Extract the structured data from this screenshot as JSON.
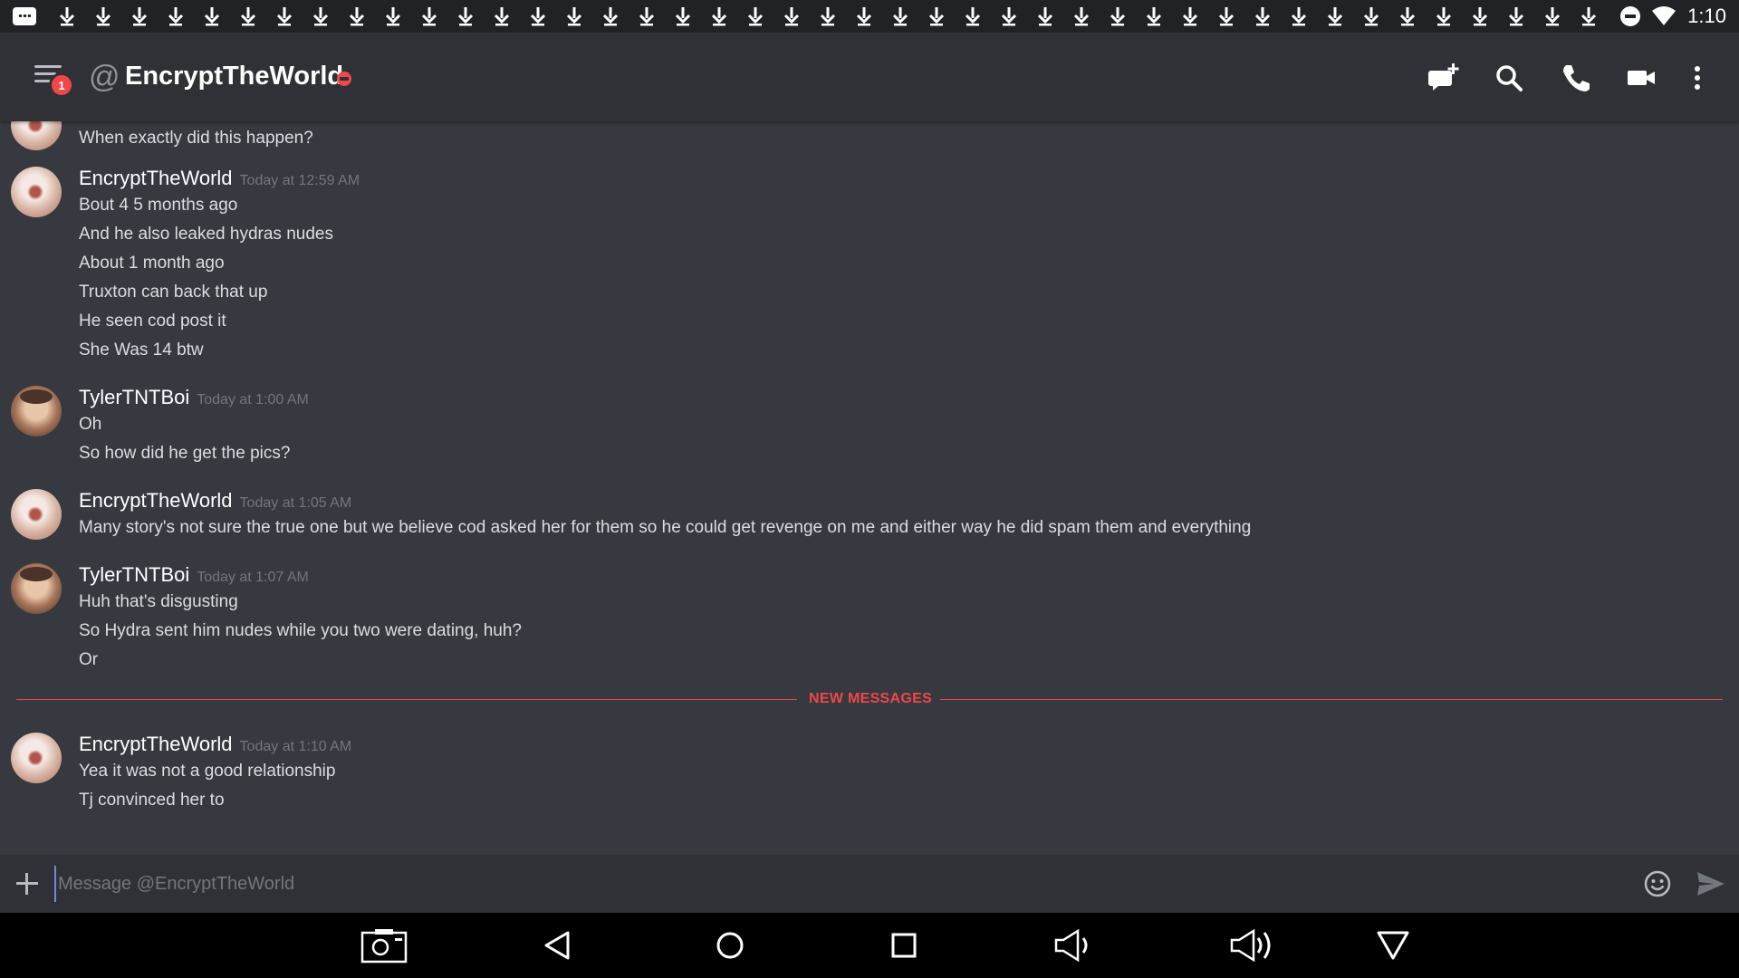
{
  "status_bar": {
    "time": "1:10",
    "download_count": 43,
    "icons": [
      "chat-notification-icon",
      "download-icon",
      "do-not-disturb-icon",
      "wifi-icon"
    ]
  },
  "header": {
    "badge_count": "1",
    "at_symbol": "@",
    "channel_name": "EncryptTheWorld",
    "status": "do-not-disturb",
    "status_color": "#f04747",
    "icons": [
      "add-friend-chat-icon",
      "search-icon",
      "phone-icon",
      "video-camera-icon",
      "more-vertical-icon"
    ]
  },
  "messages": {
    "partial_top": {
      "lines": [
        "When exactly did this happen?"
      ]
    },
    "groups": [
      {
        "author": "EncryptTheWorld",
        "timestamp": "Today at 12:59 AM",
        "lines": [
          "Bout 4 5 months ago",
          "And he also leaked hydras nudes",
          "About 1 month ago",
          "Truxton can back that up",
          "He seen cod post it",
          "She Was 14 btw"
        ]
      },
      {
        "author": "TylerTNTBoi",
        "timestamp": "Today at 1:00 AM",
        "lines": [
          "Oh",
          "So how did he get the pics?"
        ]
      },
      {
        "author": "EncryptTheWorld",
        "timestamp": "Today at 1:05 AM",
        "lines": [
          "Many story's not sure the true one but we believe cod asked her for them so he could get revenge on me and either way he did spam them and everything"
        ]
      },
      {
        "author": "TylerTNTBoi",
        "timestamp": "Today at 1:07 AM",
        "lines": [
          "Huh that's disgusting",
          "So Hydra sent him nudes while you two were dating, huh?",
          "Or"
        ]
      },
      {
        "author": "EncryptTheWorld",
        "timestamp": "Today at 1:10 AM",
        "lines": [
          "Yea it was not a good relationship",
          "Tj convinced her to"
        ]
      }
    ],
    "new_messages_label": "NEW MESSAGES"
  },
  "composer": {
    "placeholder": "Message @EncryptTheWorld",
    "value": ""
  },
  "navbar": {
    "icons": [
      "screenshot-icon",
      "back-icon",
      "home-icon",
      "recents-icon",
      "volume-down-icon",
      "volume-up-icon",
      "collapse-icon"
    ]
  },
  "colors": {
    "background": "#36393f",
    "header_bg": "#2f3136",
    "accent_red": "#f04747",
    "text": "#dcddde",
    "muted": "#72767d"
  }
}
